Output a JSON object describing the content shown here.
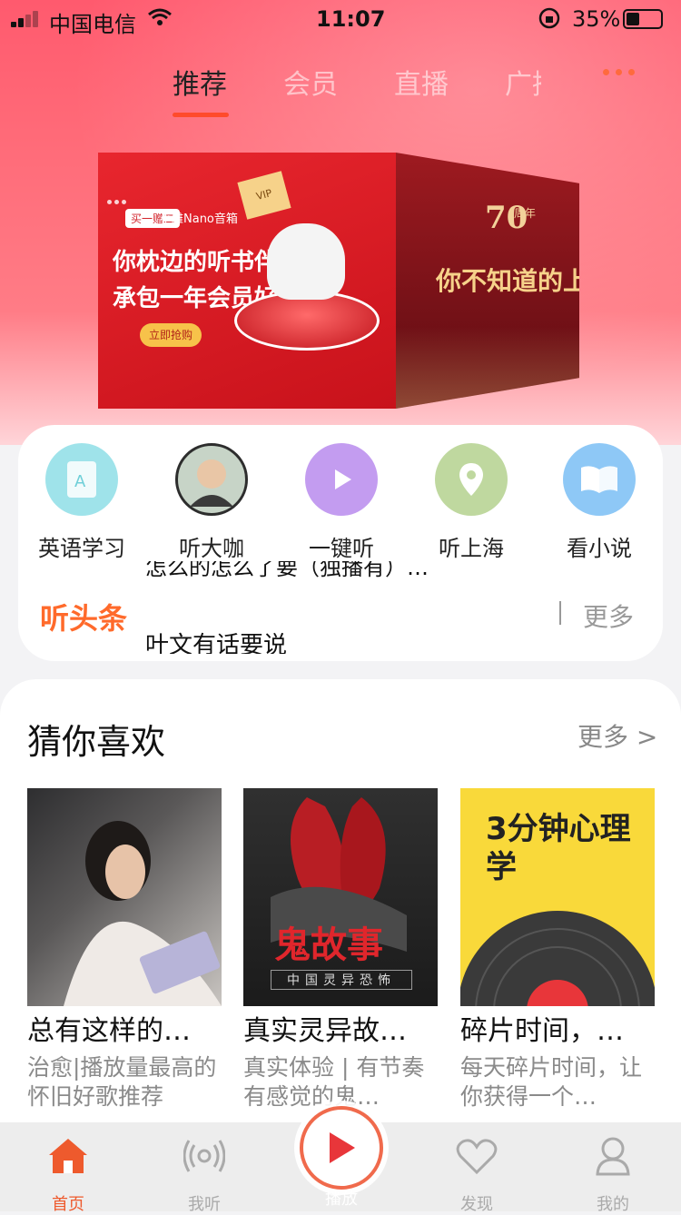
{
  "status_bar": {
    "carrier": "中国电信",
    "time": "11:07",
    "battery": "35%"
  },
  "top_tabs": [
    "推荐",
    "会员",
    "直播",
    "广播"
  ],
  "banner": {
    "front": {
      "tag": "买一赠二",
      "brand": "小雅Nano音箱",
      "line1": "你枕边的听书伴侣",
      "line2": "承包一年会员好书",
      "button": "立即抢购",
      "card": "VIP"
    },
    "side": {
      "badge": "70",
      "badge_sub": "周年",
      "title": "你不知道的上海"
    }
  },
  "quick_entries": [
    {
      "label": "英语学习",
      "icon": "english-book-icon",
      "color": "#9fe3ea"
    },
    {
      "label": "听大咖",
      "icon": "celebrity-avatar",
      "color": "#c7d4c7"
    },
    {
      "label": "一键听",
      "icon": "play-icon",
      "color": "#c39cf0"
    },
    {
      "label": "听上海",
      "icon": "location-pin-icon",
      "color": "#bfd89f"
    },
    {
      "label": "看小说",
      "icon": "open-book-icon",
      "color": "#8ec8f6"
    }
  ],
  "headline": {
    "label": "听头条",
    "prev_item": "怎么的怎么了要（独播有）…",
    "current_item": "叶文有话要说",
    "more": "更多"
  },
  "guess_section": {
    "title": "猜你喜欢",
    "more": "更多 >"
  },
  "recommendations": [
    {
      "title": "总有这样的…",
      "subtitle": "治愈|播放量最高的怀旧好歌推荐"
    },
    {
      "title": "真实灵异故…",
      "subtitle": "真实体验 | 有节奏有感觉的鬼…",
      "cover_text": "鬼故事",
      "cover_sub": "中国灵异恐怖"
    },
    {
      "title": "碎片时间，…",
      "subtitle": "每天碎片时间，让你获得一个…",
      "cover_text": "3分钟心理学"
    }
  ],
  "tab_bar": [
    {
      "label": "首页",
      "icon": "home-icon"
    },
    {
      "label": "我听",
      "icon": "radio-wave-icon"
    },
    {
      "label": "播放",
      "icon": "play-icon"
    },
    {
      "label": "发现",
      "icon": "heart-icon"
    },
    {
      "label": "我的",
      "icon": "user-icon"
    }
  ]
}
